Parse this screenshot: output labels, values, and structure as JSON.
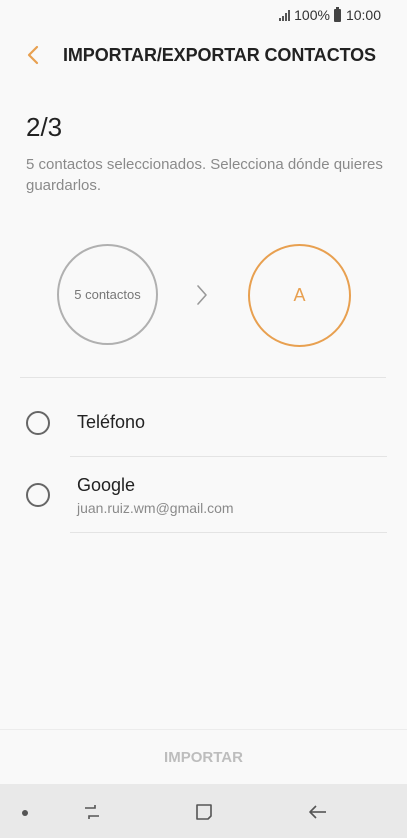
{
  "status_bar": {
    "battery": "100%",
    "time": "10:00"
  },
  "header": {
    "title": "IMPORTAR/EXPORTAR CONTACTOS"
  },
  "step": "2/3",
  "description": "5 contactos seleccionados. Selecciona dónde quieres guardarlos.",
  "flow": {
    "source_label": "5 contactos",
    "target_label": "A"
  },
  "options": [
    {
      "label": "Teléfono",
      "sub": ""
    },
    {
      "label": "Google",
      "sub": "juan.ruiz.wm@gmail.com"
    }
  ],
  "footer": {
    "import_label": "IMPORTAR"
  },
  "colors": {
    "accent": "#e8a050",
    "disabled_text": "#bdbdbd"
  }
}
